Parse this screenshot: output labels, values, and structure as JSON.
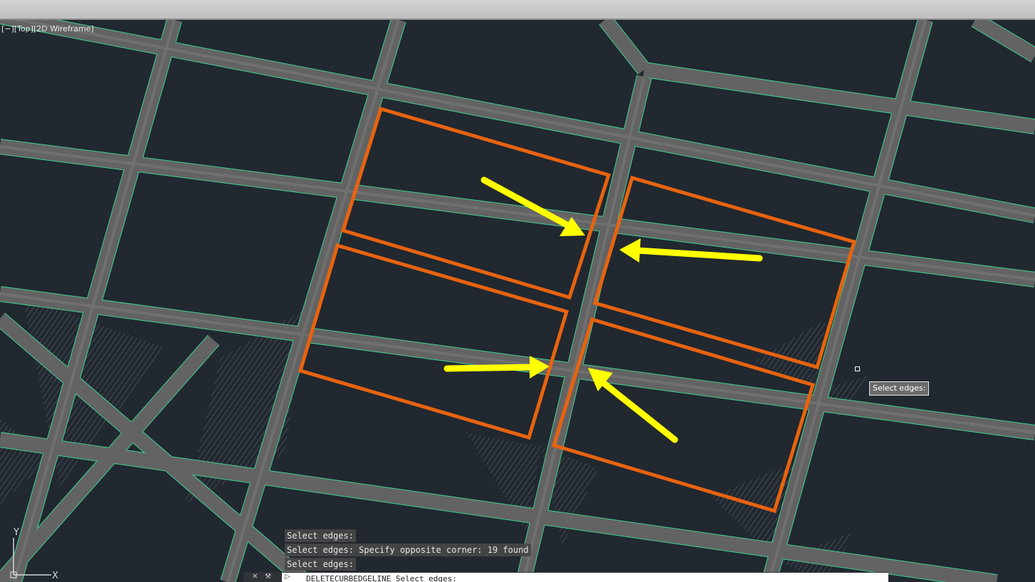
{
  "viewport": {
    "view_label": "[−][Top][2D Wireframe]",
    "background": "#212830",
    "road_color": "#636363",
    "edge_color": "#3fd08f",
    "highlight_color": "#e8630f",
    "arrow_color": "#ffff00"
  },
  "tooltip": {
    "text": "Select edges:"
  },
  "command_history": [
    "Select edges:",
    "Select edges: Specify opposite corner: 19 found",
    "Select edges:"
  ],
  "command_bar": {
    "close_icon": "close-icon",
    "settings_icon": "wrench-icon",
    "prompt_icon": "command-prompt-icon",
    "input_text": "DELETECURBEDGELINE Select edges:"
  },
  "ucs": {
    "x_label": "X",
    "y_label": "Y"
  }
}
